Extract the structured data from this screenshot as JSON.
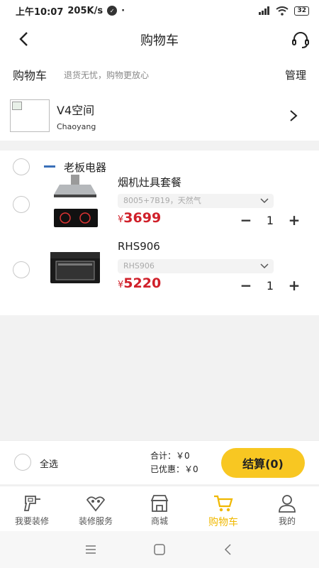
{
  "status": {
    "time": "上午10:07",
    "speed": "205K/s",
    "dot": "·",
    "battery": "32"
  },
  "nav": {
    "title": "购物车"
  },
  "subheader": {
    "label": "购物车",
    "hint": "退货无忧，购物更放心",
    "manage": "管理"
  },
  "store": {
    "name": "V4空间",
    "location": "Chaoyang"
  },
  "brand": {
    "name": "老板电器"
  },
  "products": [
    {
      "name": "烟机灶具套餐",
      "spec": "8005+7B19，天然气",
      "currency": "¥",
      "price": "3699",
      "qty_minus": "−",
      "qty": "1",
      "qty_plus": "+"
    },
    {
      "name": "RHS906",
      "spec": "RHS906",
      "currency": "¥",
      "price": "5220",
      "qty_minus": "−",
      "qty": "1",
      "qty_plus": "+"
    }
  ],
  "checkout": {
    "select_all": "全选",
    "total": "合计：￥0",
    "discount": "已优惠：￥0",
    "button": "结算(0)"
  },
  "tabs": [
    {
      "label": "我要装修",
      "icon": "drill-icon"
    },
    {
      "label": "装修服务",
      "icon": "service-icon"
    },
    {
      "label": "商城",
      "icon": "store-icon"
    },
    {
      "label": "购物车",
      "icon": "cart-icon"
    },
    {
      "label": "我的",
      "icon": "profile-icon"
    }
  ],
  "colors": {
    "accent": "#f8c722",
    "price": "#d0202a",
    "active_tab": "#f0b800"
  }
}
